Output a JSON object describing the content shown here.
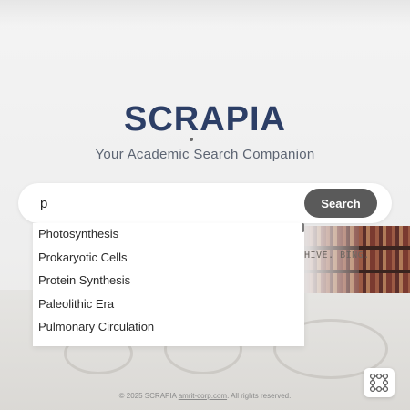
{
  "brand": {
    "title": "SCRAPIA",
    "tagline": "Your Academic Search Companion"
  },
  "background_text": "HIVE. BING.",
  "search": {
    "value": "p",
    "button_label": "Search"
  },
  "suggestions": [
    "Photosynthesis",
    "Prokaryotic Cells",
    "Protein Synthesis",
    "Paleolithic Era",
    "Pulmonary Circulation"
  ],
  "footer": {
    "prefix": "© 2025 SCRAPIA",
    "link": "amrit-corp.com",
    "suffix": ". All rights reserved."
  },
  "icons": {
    "grid_button": "grid-network-icon"
  },
  "colors": {
    "title": "#2c3e66",
    "search_button": "#5a5a5a"
  }
}
